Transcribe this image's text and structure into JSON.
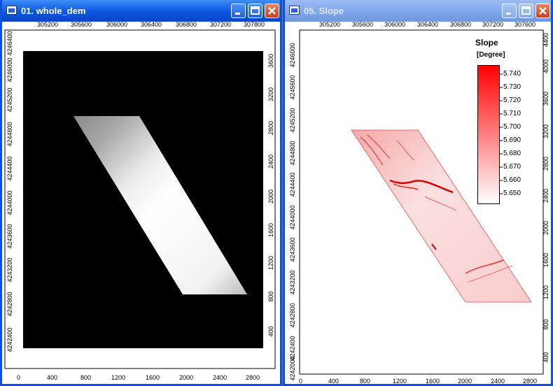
{
  "windows": [
    {
      "title": "01. whole_dem",
      "top_ticks": [
        "305200",
        "305600",
        "306000",
        "306400",
        "306800",
        "307200",
        "307800"
      ],
      "bottom_ticks": [
        "0",
        "400",
        "800",
        "1200",
        "1600",
        "2000",
        "2400",
        "2800"
      ],
      "left_ticks": [
        "4246400",
        "4246000",
        "4245200",
        "4244800",
        "4244400",
        "4244000",
        "4243600",
        "4243200",
        "4242800",
        "4242400"
      ],
      "right_ticks": [
        "3600",
        "3200",
        "2800",
        "2400",
        "2000",
        "1600",
        "1200",
        "800",
        "400"
      ]
    },
    {
      "title": "05. Slope",
      "top_ticks": [
        "305200",
        "305600",
        "306000",
        "306400",
        "306800",
        "307200",
        "307600"
      ],
      "bottom_ticks": [
        "0",
        "400",
        "800",
        "1200",
        "1600",
        "2000",
        "2400",
        "2800"
      ],
      "left_ticks": [
        "4246000",
        "4245600",
        "4245200",
        "4244800",
        "4244400",
        "4244000",
        "4243600",
        "4243200",
        "4242800",
        "4242400",
        "4242000"
      ],
      "right_ticks": [
        "4400",
        "4000",
        "3600",
        "3200",
        "2800",
        "2400",
        "2000",
        "1600",
        "1200",
        "800",
        "400"
      ],
      "legend": {
        "title": "Slope",
        "unit": "[Degree]",
        "ticks": [
          "5.740",
          "5.730",
          "5.720",
          "5.710",
          "5.700",
          "5.690",
          "5.680",
          "5.670",
          "5.660",
          "5.650"
        ],
        "color_high": "#ff0000",
        "color_low": "#ffffff"
      }
    }
  ]
}
